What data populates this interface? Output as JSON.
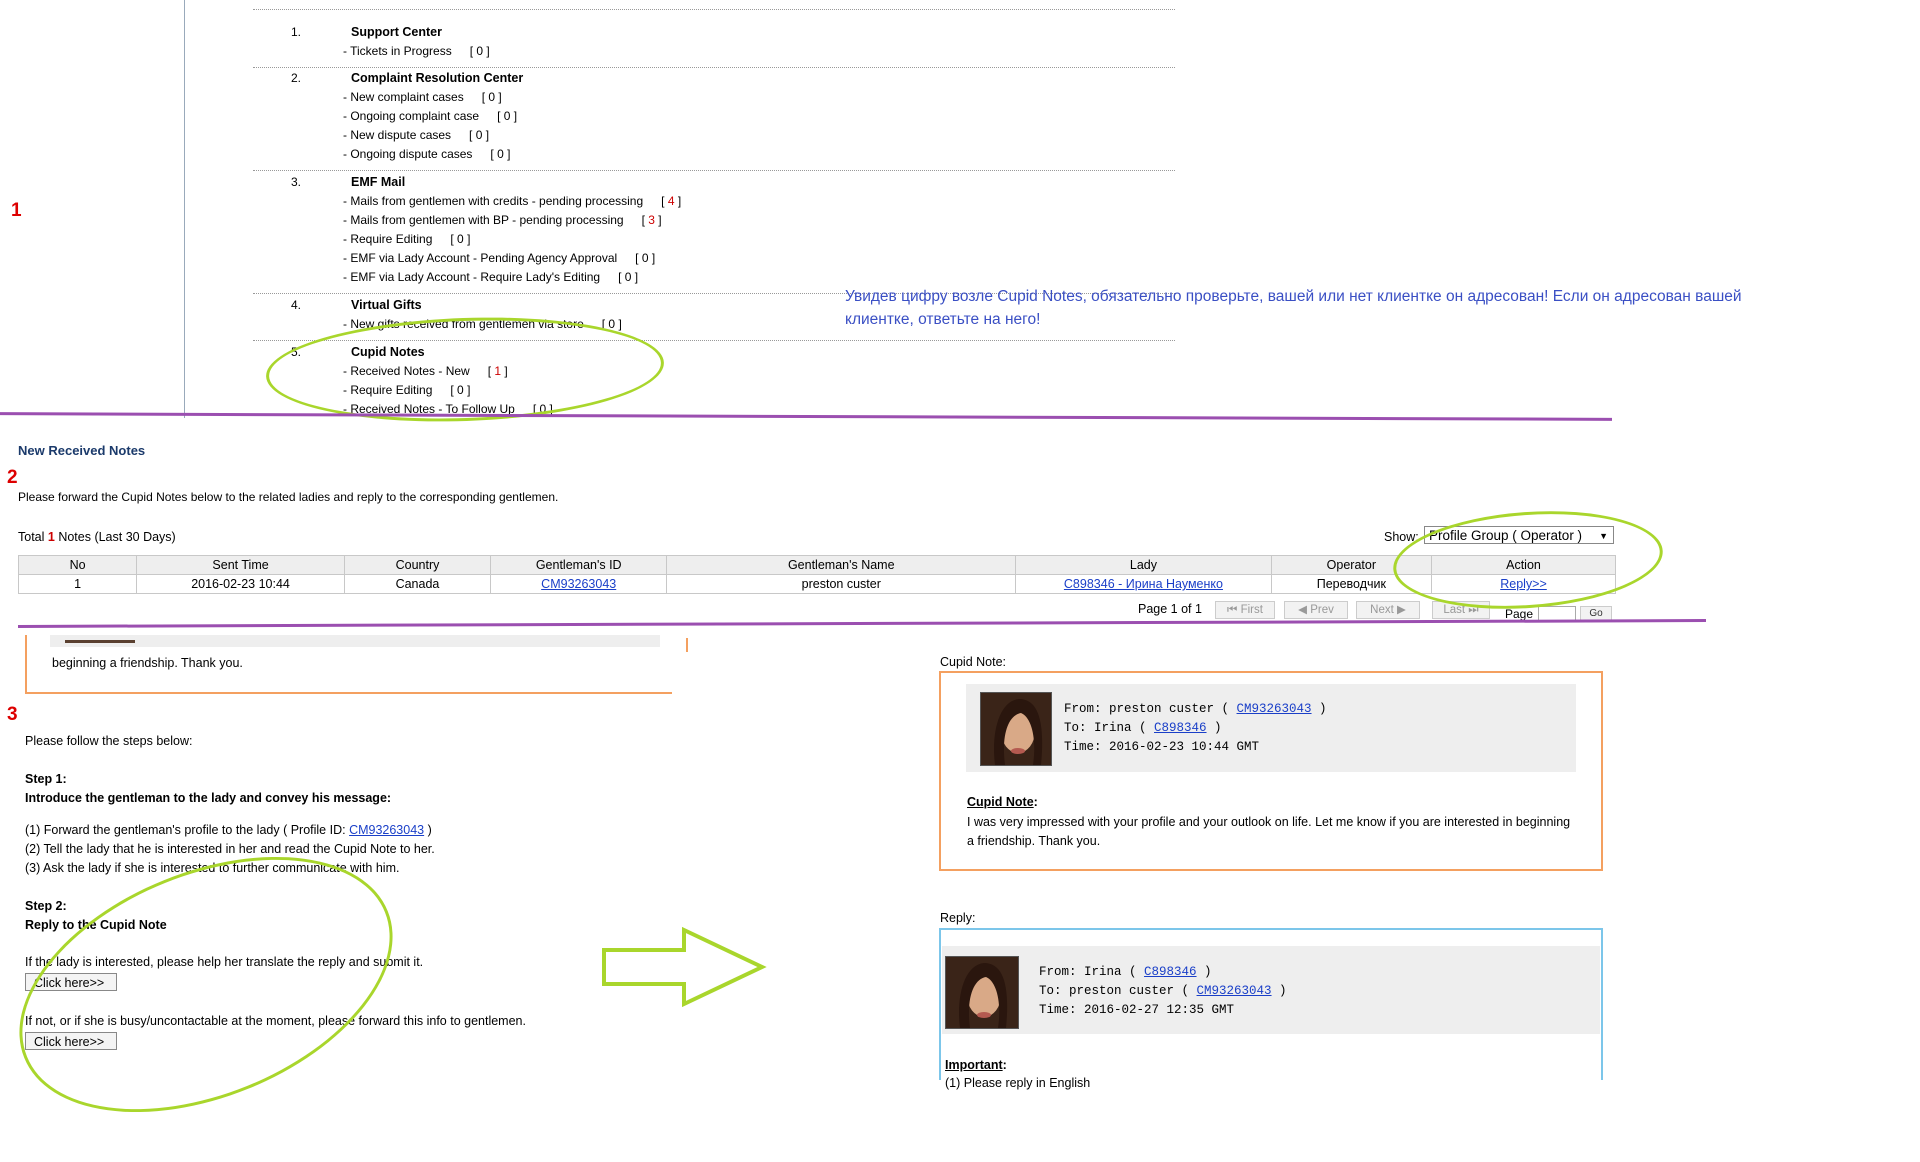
{
  "section1": {
    "marker": "1",
    "groups": [
      {
        "num": "1.",
        "title": "Support Center",
        "items": [
          {
            "label": "- Tickets in Progress",
            "count": "[ 0 ]",
            "count_val": "0",
            "highlight": false
          }
        ]
      },
      {
        "num": "2.",
        "title": "Complaint Resolution Center",
        "items": [
          {
            "label": "- New complaint cases",
            "count": "[ 0 ]",
            "count_val": "0",
            "highlight": false
          },
          {
            "label": "- Ongoing complaint case",
            "count": "[ 0 ]",
            "count_val": "0",
            "highlight": false
          },
          {
            "label": "- New dispute cases",
            "count": "[ 0 ]",
            "count_val": "0",
            "highlight": false
          },
          {
            "label": "- Ongoing dispute cases",
            "count": "[ 0 ]",
            "count_val": "0",
            "highlight": false
          }
        ]
      },
      {
        "num": "3.",
        "title": "EMF Mail",
        "items": [
          {
            "label": "- Mails from gentlemen with credits - pending processing",
            "count": "[ 4 ]",
            "count_val": "4",
            "highlight": true
          },
          {
            "label": "- Mails from gentlemen with BP - pending processing",
            "count": "[ 3 ]",
            "count_val": "3",
            "highlight": true
          },
          {
            "label": "- Require Editing",
            "count": "[ 0 ]",
            "count_val": "0",
            "highlight": false
          },
          {
            "label": "- EMF via Lady Account - Pending Agency Approval",
            "count": "[ 0 ]",
            "count_val": "0",
            "highlight": false
          },
          {
            "label": "- EMF via Lady Account - Require Lady's Editing",
            "count": "[ 0 ]",
            "count_val": "0",
            "highlight": false
          }
        ]
      },
      {
        "num": "4.",
        "title": "Virtual Gifts",
        "items": [
          {
            "label": "- New gifts received from gentlemen via store",
            "count": "[ 0 ]",
            "count_val": "0",
            "highlight": false
          }
        ]
      },
      {
        "num": "5.",
        "title": "Cupid Notes",
        "items": [
          {
            "label": "- Received Notes - New",
            "count": "[ 1 ]",
            "count_val": "1",
            "highlight": true
          },
          {
            "label": "- Require Editing",
            "count": "[ 0 ]",
            "count_val": "0",
            "highlight": false
          },
          {
            "label": "- Received Notes - To Follow Up",
            "count": "[ 0 ]",
            "count_val": "0",
            "highlight": false
          }
        ]
      }
    ],
    "annotation": "Увидев  цифру возле Cupid Notes, обязательно проверьте,  вашей или нет клиентке он адресован! Если он адресован вашей клиентке, ответьте на него!"
  },
  "section2": {
    "marker": "2",
    "heading": "New Received Notes",
    "instruction": "Please forward the Cupid Notes below to the related ladies and reply to the corresponding gentlemen.",
    "total_prefix": "Total ",
    "total_count": "1",
    "total_suffix": " Notes  (Last 30 Days)",
    "show_label": "Show:",
    "show_value": "Profile Group ( Operator )",
    "columns": [
      "No",
      "Sent Time",
      "Country",
      "Gentleman's ID",
      "Gentleman's Name",
      "Lady",
      "Operator",
      "Action"
    ],
    "rows": [
      {
        "no": "1",
        "sent_time": "2016-02-23 10:44",
        "country": "Canada",
        "gentleman_id": "CM93263043",
        "gentleman_name": "preston custer",
        "lady": "C898346 - Ирина Науменко",
        "operator": "Переводчик",
        "action": "Reply>>"
      }
    ],
    "pager": {
      "text": "Page 1 of 1",
      "first": "⏮ First",
      "prev": "◀ Prev",
      "next": "Next ▶",
      "last": "Last ⏭",
      "page_label": "Page",
      "go": "Go"
    }
  },
  "section3": {
    "marker": "3",
    "prev_note_tail": "beginning a friendship. Thank you.",
    "follow_steps": "Please follow the steps below:",
    "step1_title": "Step 1:",
    "step1_sub": "Introduce the gentleman to the lady and convey his message:",
    "step1_line1_pre": "(1) Forward the gentleman's profile to the lady ( Profile ID: ",
    "step1_line1_id": "CM93263043",
    "step1_line1_post": " )",
    "step1_line2": "(2) Tell the lady that he is interested in her and read the Cupid Note to her.",
    "step1_line3": "(3) Ask the lady if she is interested to further communicate with him.",
    "step2_title": "Step 2:",
    "step2_sub": "Reply to the Cupid Note",
    "step2_yes": "If the lady is interested, please help her translate the reply and submit it.",
    "step2_no": "If not, or if she is busy/uncontactable at the moment, please forward this info to gentlemen.",
    "click_here": "Click here>>",
    "cupid_note_label": "Cupid Note:",
    "note_from_pre": "From: preston custer ( ",
    "note_from_id": "CM93263043",
    "note_from_post": " )",
    "note_to_pre": "To: Irina ( ",
    "note_to_id": "C898346",
    "note_to_post": " )",
    "note_time": "Time: 2016-02-23 10:44 GMT",
    "note_heading": "Cupid Note",
    "note_heading_colon": ":",
    "note_body": "I was very impressed with your profile and your outlook on life. Let me know if you are interested in beginning a friendship. Thank you.",
    "reply_label": "Reply:",
    "reply_from_pre": "From: Irina ( ",
    "reply_from_id": "C898346",
    "reply_from_post": " )",
    "reply_to_pre": "To: preston custer ( ",
    "reply_to_id": "CM93263043",
    "reply_to_post": " )",
    "reply_time": "Time: 2016-02-27 12:35 GMT",
    "important_heading": "Important",
    "important_colon": ":",
    "important_line1": "(1) Please reply in English"
  },
  "colors": {
    "highlight_ellipse": "#a9d62c",
    "divider": "#9b4fb0",
    "annotation_text": "#3a4fc4",
    "marker": "#dd0000"
  }
}
